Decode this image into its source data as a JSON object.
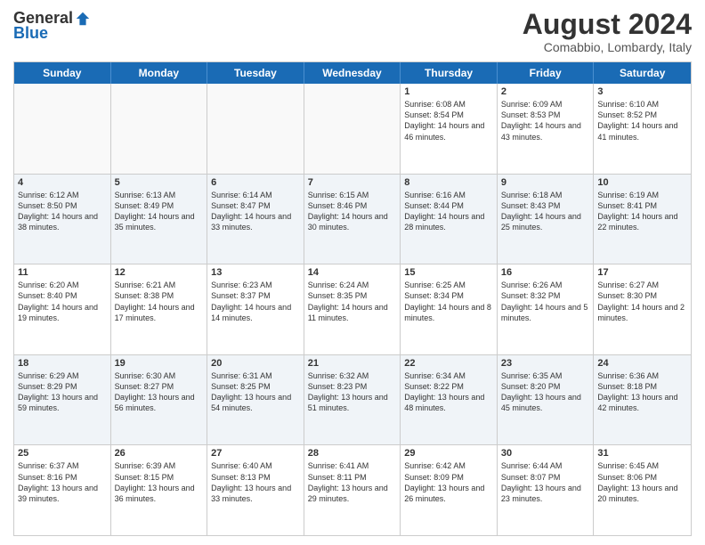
{
  "header": {
    "logo_general": "General",
    "logo_blue": "Blue",
    "month_title": "August 2024",
    "location": "Comabbio, Lombardy, Italy"
  },
  "days_of_week": [
    "Sunday",
    "Monday",
    "Tuesday",
    "Wednesday",
    "Thursday",
    "Friday",
    "Saturday"
  ],
  "weeks": [
    [
      {
        "day": "",
        "info": ""
      },
      {
        "day": "",
        "info": ""
      },
      {
        "day": "",
        "info": ""
      },
      {
        "day": "",
        "info": ""
      },
      {
        "day": "1",
        "info": "Sunrise: 6:08 AM\nSunset: 8:54 PM\nDaylight: 14 hours and 46 minutes."
      },
      {
        "day": "2",
        "info": "Sunrise: 6:09 AM\nSunset: 8:53 PM\nDaylight: 14 hours and 43 minutes."
      },
      {
        "day": "3",
        "info": "Sunrise: 6:10 AM\nSunset: 8:52 PM\nDaylight: 14 hours and 41 minutes."
      }
    ],
    [
      {
        "day": "4",
        "info": "Sunrise: 6:12 AM\nSunset: 8:50 PM\nDaylight: 14 hours and 38 minutes."
      },
      {
        "day": "5",
        "info": "Sunrise: 6:13 AM\nSunset: 8:49 PM\nDaylight: 14 hours and 35 minutes."
      },
      {
        "day": "6",
        "info": "Sunrise: 6:14 AM\nSunset: 8:47 PM\nDaylight: 14 hours and 33 minutes."
      },
      {
        "day": "7",
        "info": "Sunrise: 6:15 AM\nSunset: 8:46 PM\nDaylight: 14 hours and 30 minutes."
      },
      {
        "day": "8",
        "info": "Sunrise: 6:16 AM\nSunset: 8:44 PM\nDaylight: 14 hours and 28 minutes."
      },
      {
        "day": "9",
        "info": "Sunrise: 6:18 AM\nSunset: 8:43 PM\nDaylight: 14 hours and 25 minutes."
      },
      {
        "day": "10",
        "info": "Sunrise: 6:19 AM\nSunset: 8:41 PM\nDaylight: 14 hours and 22 minutes."
      }
    ],
    [
      {
        "day": "11",
        "info": "Sunrise: 6:20 AM\nSunset: 8:40 PM\nDaylight: 14 hours and 19 minutes."
      },
      {
        "day": "12",
        "info": "Sunrise: 6:21 AM\nSunset: 8:38 PM\nDaylight: 14 hours and 17 minutes."
      },
      {
        "day": "13",
        "info": "Sunrise: 6:23 AM\nSunset: 8:37 PM\nDaylight: 14 hours and 14 minutes."
      },
      {
        "day": "14",
        "info": "Sunrise: 6:24 AM\nSunset: 8:35 PM\nDaylight: 14 hours and 11 minutes."
      },
      {
        "day": "15",
        "info": "Sunrise: 6:25 AM\nSunset: 8:34 PM\nDaylight: 14 hours and 8 minutes."
      },
      {
        "day": "16",
        "info": "Sunrise: 6:26 AM\nSunset: 8:32 PM\nDaylight: 14 hours and 5 minutes."
      },
      {
        "day": "17",
        "info": "Sunrise: 6:27 AM\nSunset: 8:30 PM\nDaylight: 14 hours and 2 minutes."
      }
    ],
    [
      {
        "day": "18",
        "info": "Sunrise: 6:29 AM\nSunset: 8:29 PM\nDaylight: 13 hours and 59 minutes."
      },
      {
        "day": "19",
        "info": "Sunrise: 6:30 AM\nSunset: 8:27 PM\nDaylight: 13 hours and 56 minutes."
      },
      {
        "day": "20",
        "info": "Sunrise: 6:31 AM\nSunset: 8:25 PM\nDaylight: 13 hours and 54 minutes."
      },
      {
        "day": "21",
        "info": "Sunrise: 6:32 AM\nSunset: 8:23 PM\nDaylight: 13 hours and 51 minutes."
      },
      {
        "day": "22",
        "info": "Sunrise: 6:34 AM\nSunset: 8:22 PM\nDaylight: 13 hours and 48 minutes."
      },
      {
        "day": "23",
        "info": "Sunrise: 6:35 AM\nSunset: 8:20 PM\nDaylight: 13 hours and 45 minutes."
      },
      {
        "day": "24",
        "info": "Sunrise: 6:36 AM\nSunset: 8:18 PM\nDaylight: 13 hours and 42 minutes."
      }
    ],
    [
      {
        "day": "25",
        "info": "Sunrise: 6:37 AM\nSunset: 8:16 PM\nDaylight: 13 hours and 39 minutes."
      },
      {
        "day": "26",
        "info": "Sunrise: 6:39 AM\nSunset: 8:15 PM\nDaylight: 13 hours and 36 minutes."
      },
      {
        "day": "27",
        "info": "Sunrise: 6:40 AM\nSunset: 8:13 PM\nDaylight: 13 hours and 33 minutes."
      },
      {
        "day": "28",
        "info": "Sunrise: 6:41 AM\nSunset: 8:11 PM\nDaylight: 13 hours and 29 minutes."
      },
      {
        "day": "29",
        "info": "Sunrise: 6:42 AM\nSunset: 8:09 PM\nDaylight: 13 hours and 26 minutes."
      },
      {
        "day": "30",
        "info": "Sunrise: 6:44 AM\nSunset: 8:07 PM\nDaylight: 13 hours and 23 minutes."
      },
      {
        "day": "31",
        "info": "Sunrise: 6:45 AM\nSunset: 8:06 PM\nDaylight: 13 hours and 20 minutes."
      }
    ]
  ]
}
